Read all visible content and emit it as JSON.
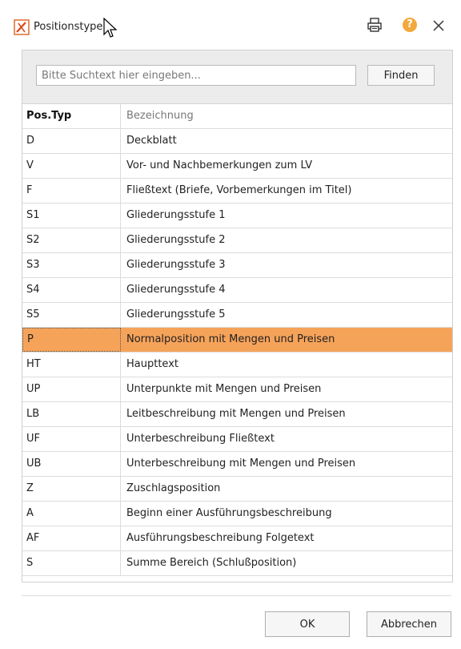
{
  "window": {
    "title": "Positionstypen",
    "app_icon": "app-logo-icon",
    "print_icon": "printer-icon",
    "help_icon": "help-icon",
    "help_glyph": "?",
    "close_icon": "close-icon",
    "accent_color": "#f6a35a",
    "help_color": "#f2a93b"
  },
  "search": {
    "placeholder": "Bitte Suchtext hier eingeben...",
    "value": "",
    "find_label": "Finden"
  },
  "table": {
    "columns": [
      "Pos.Typ",
      "Bezeichnung"
    ],
    "selected_code": "P",
    "rows": [
      {
        "code": "D",
        "name": "Deckblatt"
      },
      {
        "code": "V",
        "name": "Vor- und Nachbemerkungen zum LV"
      },
      {
        "code": "F",
        "name": "Fließtext (Briefe, Vorbemerkungen im Titel)"
      },
      {
        "code": "S1",
        "name": "Gliederungsstufe 1"
      },
      {
        "code": "S2",
        "name": "Gliederungsstufe 2"
      },
      {
        "code": "S3",
        "name": "Gliederungsstufe 3"
      },
      {
        "code": "S4",
        "name": "Gliederungsstufe 4"
      },
      {
        "code": "S5",
        "name": "Gliederungsstufe 5"
      },
      {
        "code": "P",
        "name": "Normalposition mit Mengen und Preisen"
      },
      {
        "code": "HT",
        "name": "Haupttext"
      },
      {
        "code": "UP",
        "name": "Unterpunkte mit Mengen und Preisen"
      },
      {
        "code": "LB",
        "name": "Leitbeschreibung mit Mengen und Preisen"
      },
      {
        "code": "UF",
        "name": "Unterbeschreibung Fließtext"
      },
      {
        "code": "UB",
        "name": "Unterbeschreibung mit Mengen und Preisen"
      },
      {
        "code": "Z",
        "name": "Zuschlagsposition"
      },
      {
        "code": "A",
        "name": "Beginn einer Ausführungsbeschreibung"
      },
      {
        "code": "AF",
        "name": "Ausführungsbeschreibung Folgetext"
      },
      {
        "code": "S",
        "name": "Summe Bereich (Schlußposition)"
      }
    ]
  },
  "footer": {
    "ok_label": "OK",
    "cancel_label": "Abbrechen"
  }
}
